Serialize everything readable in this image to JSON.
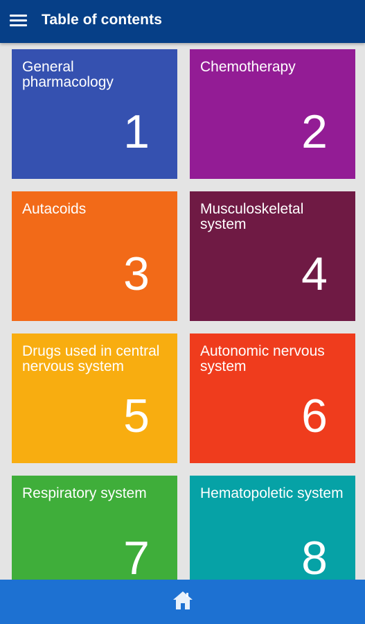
{
  "app_bar": {
    "title": "Table of contents",
    "menu_icon": "hamburger-menu-icon",
    "background": "#063f87"
  },
  "tiles": [
    {
      "label": "General pharmacology",
      "number": "1",
      "color": "#3551b0"
    },
    {
      "label": "Chemotherapy",
      "number": "2",
      "color": "#931c95"
    },
    {
      "label": "Autacoids",
      "number": "3",
      "color": "#f26a18"
    },
    {
      "label": "Musculoskeletal system",
      "number": "4",
      "color": "#6f1a44"
    },
    {
      "label": "Drugs used in central nervous system",
      "number": "5",
      "color": "#f8ad10"
    },
    {
      "label": "Autonomic nervous system",
      "number": "6",
      "color": "#ef3c1d"
    },
    {
      "label": "Respiratory system",
      "number": "7",
      "color": "#3fae3a"
    },
    {
      "label": "Hematopoletic system",
      "number": "8",
      "color": "#06a2a6"
    }
  ],
  "bottom_bar": {
    "home_icon": "home-icon",
    "background": "#1d71d2"
  }
}
